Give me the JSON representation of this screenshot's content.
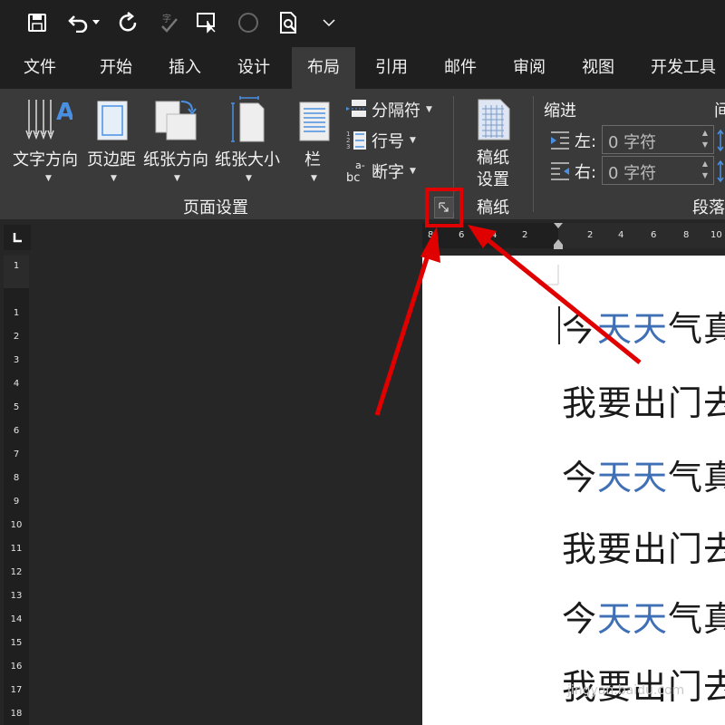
{
  "tabs": [
    {
      "label": "文件"
    },
    {
      "label": "开始"
    },
    {
      "label": "插入"
    },
    {
      "label": "设计"
    },
    {
      "label": "布局"
    },
    {
      "label": "引用"
    },
    {
      "label": "邮件"
    },
    {
      "label": "审阅"
    },
    {
      "label": "视图"
    },
    {
      "label": "开发工具"
    }
  ],
  "ribbon": {
    "text_direction": "文字方向",
    "margins": "页边距",
    "orientation": "纸张方向",
    "size": "纸张大小",
    "columns": "栏",
    "breaks": "分隔符",
    "line_numbers": "行号",
    "hyphenation": "断字",
    "page_setup_group": "页面设置",
    "draft_line1": "稿纸",
    "draft_line2": "设置",
    "draft_group": "稿纸",
    "indent_title": "缩进",
    "indent_left_label": "左:",
    "indent_left_value": "0 字符",
    "indent_right_label": "右:",
    "indent_right_value": "0 字符",
    "spacing_title_partial": "间",
    "paragraph_group": "段落"
  },
  "hruler_ticks": [
    "8",
    "6",
    "4",
    "2",
    "2",
    "4",
    "6",
    "8",
    "10"
  ],
  "vruler_ticks": [
    "1",
    "1",
    "2",
    "3",
    "4",
    "5",
    "6",
    "7",
    "8",
    "9",
    "10",
    "11",
    "12",
    "13",
    "14",
    "15",
    "16",
    "17",
    "18"
  ],
  "document": {
    "lines": [
      {
        "pre": "今",
        "blue": "天天",
        "post": "气真"
      },
      {
        "pre": "我要出门去",
        "blue": "",
        "post": ""
      },
      {
        "pre": "今",
        "blue": "天天",
        "post": "气真"
      },
      {
        "pre": "我要出门去",
        "blue": "",
        "post": ""
      },
      {
        "pre": "今",
        "blue": "天天",
        "post": "气真"
      },
      {
        "pre": "我要出门去",
        "blue": "",
        "post": ""
      }
    ]
  },
  "watermark": "jingyan.baidu.com",
  "colors": {
    "accent_blue": "#3f6fb5",
    "annotation_red": "#e00000"
  }
}
